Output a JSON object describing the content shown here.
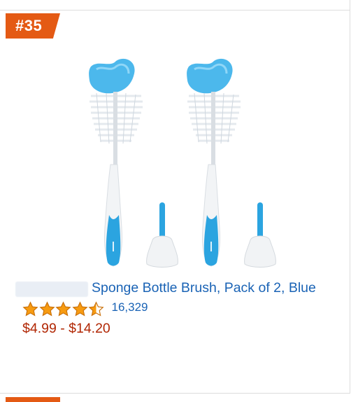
{
  "card": {
    "rank": "#35",
    "title": "Sponge Bottle Brush, Pack of 2, Blue",
    "rating": 4.5,
    "rating_max": 5,
    "review_count": "16,329",
    "price": "$4.99 - $14.20"
  },
  "colors": {
    "badge": "#e45a14",
    "link": "#1a63b5",
    "price": "#b12704",
    "star": "#f79b11",
    "product_blue": "#2ba4e0"
  },
  "icons": {
    "star_full": "star-icon",
    "star_half": "star-half-icon"
  }
}
